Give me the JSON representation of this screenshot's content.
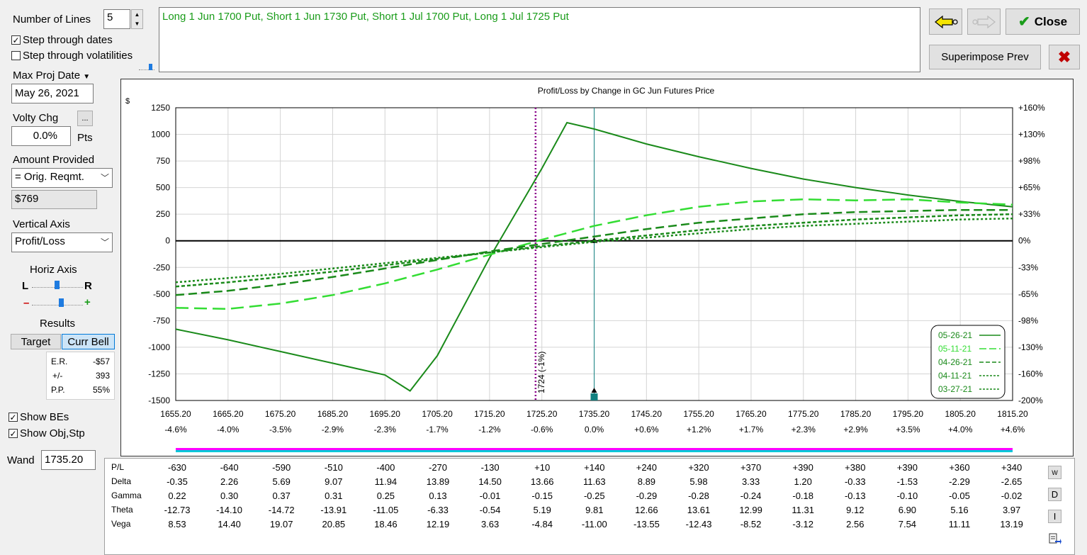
{
  "controls": {
    "num_lines_label": "Number of Lines",
    "num_lines_value": "5",
    "step_dates_label": "Step through dates",
    "step_dates_checked": true,
    "step_vols_label": "Step through volatilities",
    "step_vols_checked": false,
    "max_proj_date_label": "Max Proj Date",
    "max_proj_date_value": "May 26, 2021",
    "volty_chg_label": "Volty Chg",
    "volty_btn_label": "...",
    "volty_value": "0.0%",
    "volty_unit": "Pts",
    "amount_label": "Amount Provided",
    "amount_select": "= Orig. Reqmt.",
    "amount_value": "$769",
    "vertical_axis_label": "Vertical Axis",
    "vertical_axis_select": "Profit/Loss",
    "horiz_axis_label": "Horiz Axis",
    "horiz_left": "L",
    "horiz_right": "R",
    "zoom_minus": "–",
    "zoom_plus": "+",
    "results_label": "Results",
    "target_tab": "Target",
    "curr_bell_tab": "Curr Bell",
    "results": [
      {
        "label": "E.R.",
        "value": "-$57"
      },
      {
        "label": "+/-",
        "value": "393"
      },
      {
        "label": "P.P.",
        "value": "55%"
      }
    ],
    "show_bes_label": "Show BEs",
    "show_bes_checked": true,
    "show_obj_label": "Show Obj,Stp",
    "show_obj_checked": true,
    "wand_label": "Wand",
    "wand_value": "1735.20"
  },
  "strategy_text": "Long 1 Jun 1700 Put, Short 1 Jun 1730 Put, Short 1 Jul 1700 Put, Long 1 Jul 1725 Put",
  "buttons": {
    "close_label": "Close",
    "superimpose_label": "Superimpose Prev",
    "back_icon": "arrow-left-icon",
    "forward_icon": "arrow-right-icon"
  },
  "colors": {
    "green_dark": "#1a8a1a",
    "green_light": "#33dd33",
    "marker_purple": "#8b008b",
    "wand_teal": "#138080"
  },
  "chart_data": {
    "type": "line",
    "title": "Profit/Loss by Change in GC Jun Futures Price",
    "ylabel": "$",
    "ylim": [
      -1500,
      1250
    ],
    "y_ticks": [
      "1250",
      "1000",
      "750",
      "500",
      "250",
      "0",
      "-250",
      "-500",
      "-750",
      "-1000",
      "-1250",
      "-1500"
    ],
    "y2_ticks": [
      "+160%",
      "+130%",
      "+98%",
      "+65%",
      "+33%",
      "0%",
      "-33%",
      "-65%",
      "-98%",
      "-130%",
      "-160%",
      "-200%"
    ],
    "x_ticks": [
      "1655.20",
      "1665.20",
      "1675.20",
      "1685.20",
      "1695.20",
      "1705.20",
      "1715.20",
      "1725.20",
      "1735.20",
      "1745.20",
      "1755.20",
      "1765.20",
      "1775.20",
      "1785.20",
      "1795.20",
      "1805.20",
      "1815.20"
    ],
    "x_pct_ticks": [
      "-4.6%",
      "-4.0%",
      "-3.5%",
      "-2.9%",
      "-2.3%",
      "-1.7%",
      "-1.2%",
      "-0.6%",
      "0.0%",
      "+0.6%",
      "+1.2%",
      "+1.7%",
      "+2.3%",
      "+2.9%",
      "+3.5%",
      "+4.0%",
      "+4.6%"
    ],
    "xlim": [
      1655.2,
      1815.2
    ],
    "current_price": 1735.2,
    "marker_price": 1724,
    "marker_label": "1724 (-1%)",
    "grid": true,
    "legend_position": "bottom-right",
    "series": [
      {
        "name": "05-26-21",
        "color": "#1a8a1a",
        "style": "solid",
        "x": [
          1655.2,
          1665.2,
          1675.2,
          1685.2,
          1695.2,
          1700,
          1705.2,
          1715.2,
          1725.2,
          1730,
          1735.2,
          1745.2,
          1755.2,
          1765.2,
          1775.2,
          1785.2,
          1795.2,
          1805.2,
          1815.2
        ],
        "y": [
          -830,
          -930,
          -1040,
          -1150,
          -1260,
          -1410,
          -1080,
          -160,
          680,
          1110,
          1050,
          910,
          790,
          680,
          580,
          500,
          430,
          370,
          320
        ]
      },
      {
        "name": "05-11-21",
        "color": "#33dd33",
        "style": "long-dash",
        "x": [
          1655.2,
          1665.2,
          1675.2,
          1685.2,
          1695.2,
          1705.2,
          1715.2,
          1725.2,
          1735.2,
          1745.2,
          1755.2,
          1765.2,
          1775.2,
          1785.2,
          1795.2,
          1805.2,
          1815.2
        ],
        "y": [
          -630,
          -640,
          -590,
          -510,
          -400,
          -270,
          -130,
          10,
          140,
          240,
          320,
          370,
          390,
          380,
          390,
          360,
          340
        ]
      },
      {
        "name": "04-26-21",
        "color": "#1a8a1a",
        "style": "dash",
        "x": [
          1655.2,
          1665.2,
          1675.2,
          1685.2,
          1695.2,
          1705.2,
          1715.2,
          1725.2,
          1735.2,
          1745.2,
          1755.2,
          1765.2,
          1775.2,
          1785.2,
          1795.2,
          1805.2,
          1815.2
        ],
        "y": [
          -510,
          -470,
          -410,
          -340,
          -260,
          -180,
          -100,
          -30,
          40,
          110,
          170,
          210,
          250,
          270,
          280,
          290,
          290
        ]
      },
      {
        "name": "04-11-21",
        "color": "#1a8a1a",
        "style": "short-dash",
        "x": [
          1655.2,
          1665.2,
          1675.2,
          1685.2,
          1695.2,
          1705.2,
          1715.2,
          1725.2,
          1735.2,
          1745.2,
          1755.2,
          1765.2,
          1775.2,
          1785.2,
          1795.2,
          1805.2,
          1815.2
        ],
        "y": [
          -430,
          -390,
          -340,
          -290,
          -230,
          -170,
          -110,
          -50,
          0,
          50,
          100,
          140,
          170,
          200,
          220,
          240,
          250
        ]
      },
      {
        "name": "03-27-21",
        "color": "#1a8a1a",
        "style": "dot",
        "x": [
          1655.2,
          1665.2,
          1675.2,
          1685.2,
          1695.2,
          1705.2,
          1715.2,
          1725.2,
          1735.2,
          1745.2,
          1755.2,
          1765.2,
          1775.2,
          1785.2,
          1795.2,
          1805.2,
          1815.2
        ],
        "y": [
          -390,
          -350,
          -310,
          -260,
          -210,
          -160,
          -110,
          -60,
          -10,
          30,
          70,
          110,
          140,
          160,
          180,
          200,
          210
        ]
      }
    ]
  },
  "greeks": {
    "rows": [
      {
        "label": "P/L",
        "values": [
          "-630",
          "-640",
          "-590",
          "-510",
          "-400",
          "-270",
          "-130",
          "+10",
          "+140",
          "+240",
          "+320",
          "+370",
          "+390",
          "+380",
          "+390",
          "+360",
          "+340"
        ]
      },
      {
        "label": "Delta",
        "values": [
          "-0.35",
          "2.26",
          "5.69",
          "9.07",
          "11.94",
          "13.89",
          "14.50",
          "13.66",
          "11.63",
          "8.89",
          "5.98",
          "3.33",
          "1.20",
          "-0.33",
          "-1.53",
          "-2.29",
          "-2.65"
        ]
      },
      {
        "label": "Gamma",
        "values": [
          "0.22",
          "0.30",
          "0.37",
          "0.31",
          "0.25",
          "0.13",
          "-0.01",
          "-0.15",
          "-0.25",
          "-0.29",
          "-0.28",
          "-0.24",
          "-0.18",
          "-0.13",
          "-0.10",
          "-0.05",
          "-0.02"
        ]
      },
      {
        "label": "Theta",
        "values": [
          "-12.73",
          "-14.10",
          "-14.72",
          "-13.91",
          "-11.05",
          "-6.33",
          "-0.54",
          "5.19",
          "9.81",
          "12.66",
          "13.61",
          "12.99",
          "11.31",
          "9.12",
          "6.90",
          "5.16",
          "3.97"
        ]
      },
      {
        "label": "Vega",
        "values": [
          "8.53",
          "14.40",
          "19.07",
          "20.85",
          "18.46",
          "12.19",
          "3.63",
          "-4.84",
          "-11.00",
          "-13.55",
          "-12.43",
          "-8.52",
          "-3.12",
          "2.56",
          "7.54",
          "11.11",
          "13.19"
        ]
      }
    ],
    "side_buttons": [
      "W",
      "D",
      "I"
    ]
  }
}
